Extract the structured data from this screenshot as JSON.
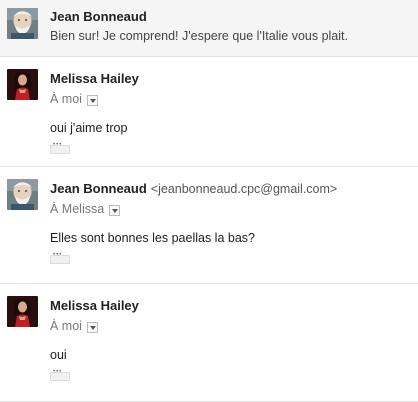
{
  "thread": {
    "messages": [
      {
        "sender": "Jean Bonneaud",
        "snippet": "Bien sur! Je comprend! J'espere que l'Italie vous plait."
      },
      {
        "sender": "Melissa Hailey",
        "recipient": "À moi",
        "body": "oui j'aime trop"
      },
      {
        "sender": "Jean Bonneaud",
        "email": "<jeanbonneaud.cpc@gmail.com>",
        "recipient": "À Melissa",
        "body": "Elles sont bonnes les paellas la bas?"
      },
      {
        "sender": "Melissa Hailey",
        "recipient": "À moi",
        "body": "oui"
      }
    ]
  },
  "icons": {
    "avatar_jean": "avatar-photo-man",
    "avatar_melissa": "avatar-photo-woman-red-dress",
    "recipient_dropdown": "chevron-down-icon",
    "show_trimmed": "ellipsis-icon"
  }
}
